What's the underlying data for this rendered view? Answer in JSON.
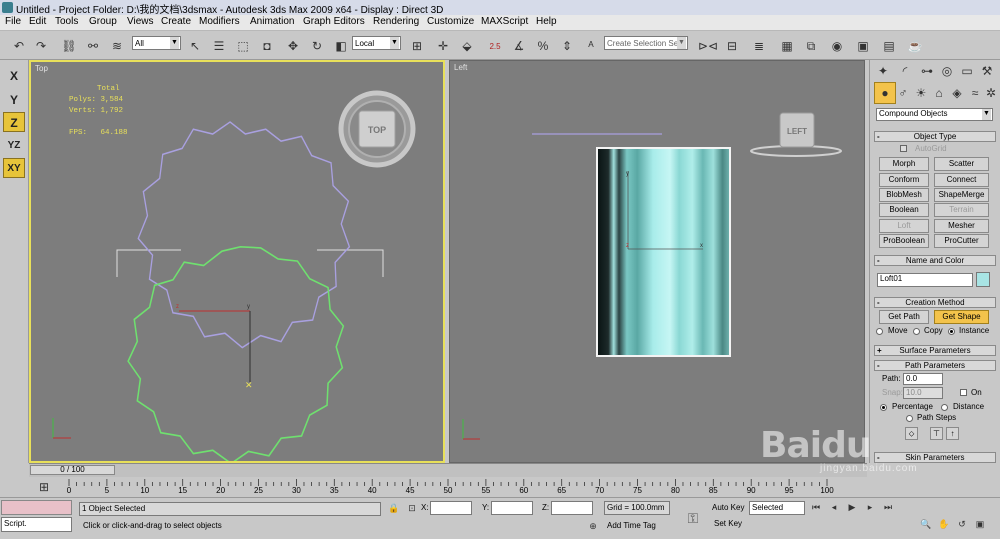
{
  "window": {
    "title": "Untitled      - Project Folder: D:\\我的文档\\3dsmax     - Autodesk 3ds Max  2009 x64      - Display : Direct 3D"
  },
  "menu": [
    "File",
    "Edit",
    "Tools",
    "Group",
    "Views",
    "Create",
    "Modifiers",
    "Animation",
    "Graph Editors",
    "Rendering",
    "Customize",
    "MAXScript",
    "Help"
  ],
  "toolbar": {
    "selection_filter": "All",
    "reference_coord": "Local",
    "snap_value": "2.5",
    "named_selection_placeholder": "Create Selection Set"
  },
  "axis_constraints": [
    {
      "label": "X",
      "active": false
    },
    {
      "label": "Y",
      "active": false
    },
    {
      "label": "Z",
      "active": true
    },
    {
      "label": "YZ",
      "active": false
    },
    {
      "label": "XY",
      "active": true
    }
  ],
  "viewports": {
    "top": {
      "label": "Top",
      "stats": {
        "header": "Total",
        "polys": "Polys: 3,584",
        "verts": "Verts: 1,792",
        "fps": "FPS:   64.188"
      },
      "viewcube_label": "TOP"
    },
    "left": {
      "label": "Left",
      "viewcube_label": "LEFT"
    }
  },
  "command_panel": {
    "category_dropdown": "Compound Objects",
    "object_type": {
      "title": "Object Type",
      "autogrid": "AutoGrid",
      "buttons": [
        {
          "label": "Morph",
          "disabled": false
        },
        {
          "label": "Scatter",
          "disabled": false
        },
        {
          "label": "Conform",
          "disabled": false
        },
        {
          "label": "Connect",
          "disabled": false
        },
        {
          "label": "BlobMesh",
          "disabled": false
        },
        {
          "label": "ShapeMerge",
          "disabled": false
        },
        {
          "label": "Boolean",
          "disabled": false
        },
        {
          "label": "Terrain",
          "disabled": true
        },
        {
          "label": "Loft",
          "disabled": true
        },
        {
          "label": "Mesher",
          "disabled": false
        },
        {
          "label": "ProBoolean",
          "disabled": false
        },
        {
          "label": "ProCutter",
          "disabled": false
        }
      ]
    },
    "name_color": {
      "title": "Name and Color",
      "name": "Loft01",
      "color": "#a8e4e4"
    },
    "creation_method": {
      "title": "Creation Method",
      "get_path": "Get Path",
      "get_shape": "Get Shape",
      "move": "Move",
      "copy": "Copy",
      "instance": "Instance"
    },
    "surface_parameters": {
      "title": "Surface Parameters"
    },
    "path_parameters": {
      "title": "Path Parameters",
      "path_label": "Path:",
      "path_value": "0.0",
      "snap_label": "Snap:",
      "snap_value": "10.0",
      "on_label": "On",
      "percentage": "Percentage",
      "distance": "Distance",
      "path_steps": "Path Steps"
    },
    "skin_parameters": {
      "title": "Skin Parameters"
    }
  },
  "timeline": {
    "slider_text": "0 / 100",
    "ticks": [
      "0",
      "5",
      "10",
      "15",
      "20",
      "25",
      "30",
      "35",
      "40",
      "45",
      "50",
      "55",
      "60",
      "65",
      "70",
      "75",
      "80",
      "85",
      "90",
      "95",
      "100"
    ]
  },
  "status": {
    "selection_info": "1 Object Selected",
    "prompt": "Click or click-and-drag to select objects",
    "x_label": "X:",
    "y_label": "Y:",
    "z_label": "Z:",
    "grid": "Grid = 100.0mm",
    "add_time_tag": "Add Time Tag",
    "auto_key": "Auto Key",
    "set_key": "Set Key",
    "key_filter": "Selected",
    "script_label": "Script."
  },
  "watermark": {
    "brand": "Baidu",
    "sub": "jingyan.baidu.com"
  }
}
